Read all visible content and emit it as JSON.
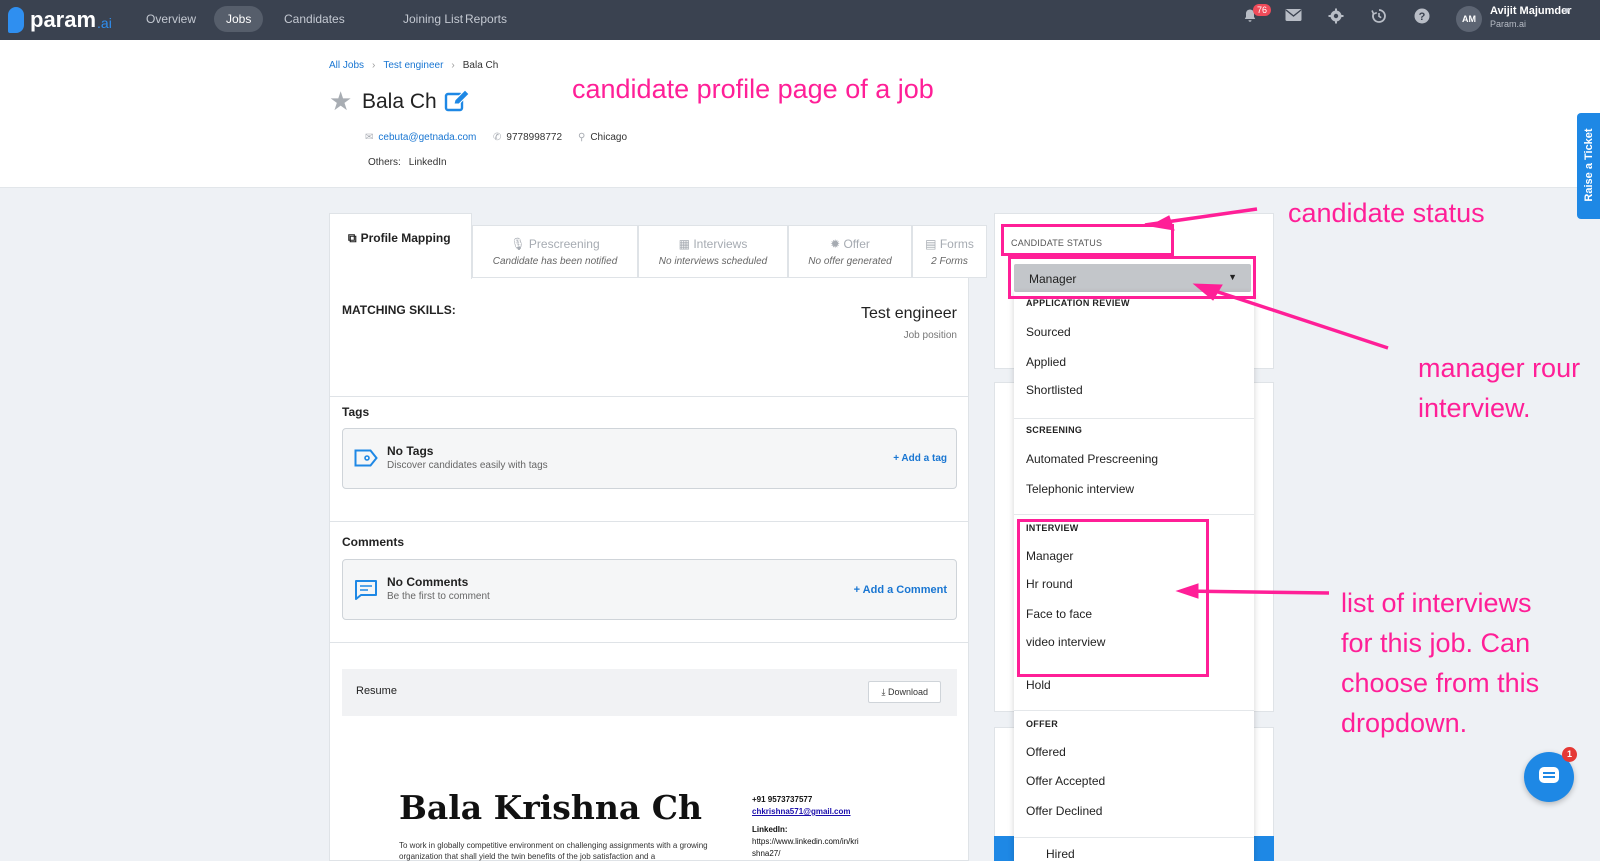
{
  "nav": {
    "logo_text": "param",
    "logo_suffix": ".ai",
    "items": [
      {
        "label": "Overview"
      },
      {
        "label": "Jobs"
      },
      {
        "label": "Candidates"
      },
      {
        "label": "Joining List"
      },
      {
        "label": "Reports"
      }
    ],
    "active_item": "Jobs",
    "notifications_count": "76",
    "user": {
      "initials": "AM",
      "name": "Avijit Majumder",
      "org": "Param.ai"
    },
    "icons": [
      "bell-icon",
      "mail-icon",
      "gear-icon",
      "history-icon",
      "help-icon"
    ]
  },
  "breadcrumb": [
    "All Jobs",
    "Test engineer",
    "Bala Ch"
  ],
  "candidate": {
    "name": "Bala Ch",
    "email": "cebuta@getnada.com",
    "phone": "9778998772",
    "location": "Chicago",
    "others_label": "Others:",
    "others_value": "LinkedIn"
  },
  "tabs": [
    {
      "title": "Profile Mapping",
      "subtitle": ""
    },
    {
      "title": "Prescreening",
      "subtitle": "Candidate has been notified"
    },
    {
      "title": "Interviews",
      "subtitle": "No interviews scheduled"
    },
    {
      "title": "Offer",
      "subtitle": "No offer generated"
    },
    {
      "title": "Forms",
      "subtitle": "2 Forms"
    }
  ],
  "profile": {
    "matching_skills_label": "MATCHING SKILLS:",
    "job_position_title": "Test engineer",
    "job_position_label": "Job position",
    "tags_label": "Tags",
    "tags_empty_title": "No Tags",
    "tags_empty_sub": "Discover candidates easily with tags",
    "tags_add": "+ Add a tag",
    "comments_label": "Comments",
    "comments_empty_title": "No Comments",
    "comments_empty_sub": "Be the first to comment",
    "comments_add": "+ Add a Comment",
    "resume_label": "Resume",
    "download_label": "Download"
  },
  "resume": {
    "name": "Bala Krishna Ch",
    "objective": "To work in globally competitive environment on challenging assignments with a growing organization that shall yield the twin benefits of the job satisfaction and a",
    "phone": "+91 9573737577",
    "email": "chkrishna571@gmail.com",
    "linkedin_label": "LinkedIn:",
    "linkedin_url": "https://www.linkedin.com/in/kri shna27/"
  },
  "status": {
    "label": "CANDIDATE STATUS",
    "selected": "Manager",
    "groups": [
      {
        "header": "APPLICATION REVIEW",
        "items": [
          "Sourced",
          "Applied",
          "Shortlisted"
        ]
      },
      {
        "header": "SCREENING",
        "items": [
          "Automated Prescreening",
          "Telephonic interview"
        ]
      },
      {
        "header": "INTERVIEW",
        "items": [
          "Manager",
          "Hr round",
          "Face to face",
          "video interview",
          "Hold"
        ]
      },
      {
        "header": "OFFER",
        "items": [
          "Offered",
          "Offer Accepted",
          "Offer Declined"
        ]
      }
    ],
    "partial_item": "Hired"
  },
  "annotations": {
    "page": "candidate profile page of a job",
    "status": "candidate status",
    "manager_line1": "manager rour",
    "manager_line2": "interview.",
    "list_line1": "list of interviews",
    "list_line2": "for this job. Can",
    "list_line3": "choose from this",
    "list_line4": "dropdown."
  },
  "widgets": {
    "raise_ticket": "Raise a Ticket",
    "chat_badge": "1"
  },
  "colors": {
    "accent": "#1e88e5",
    "annotation": "#ff1f97",
    "nav_bg": "#3a4250",
    "badge": "#ef4b5a"
  }
}
